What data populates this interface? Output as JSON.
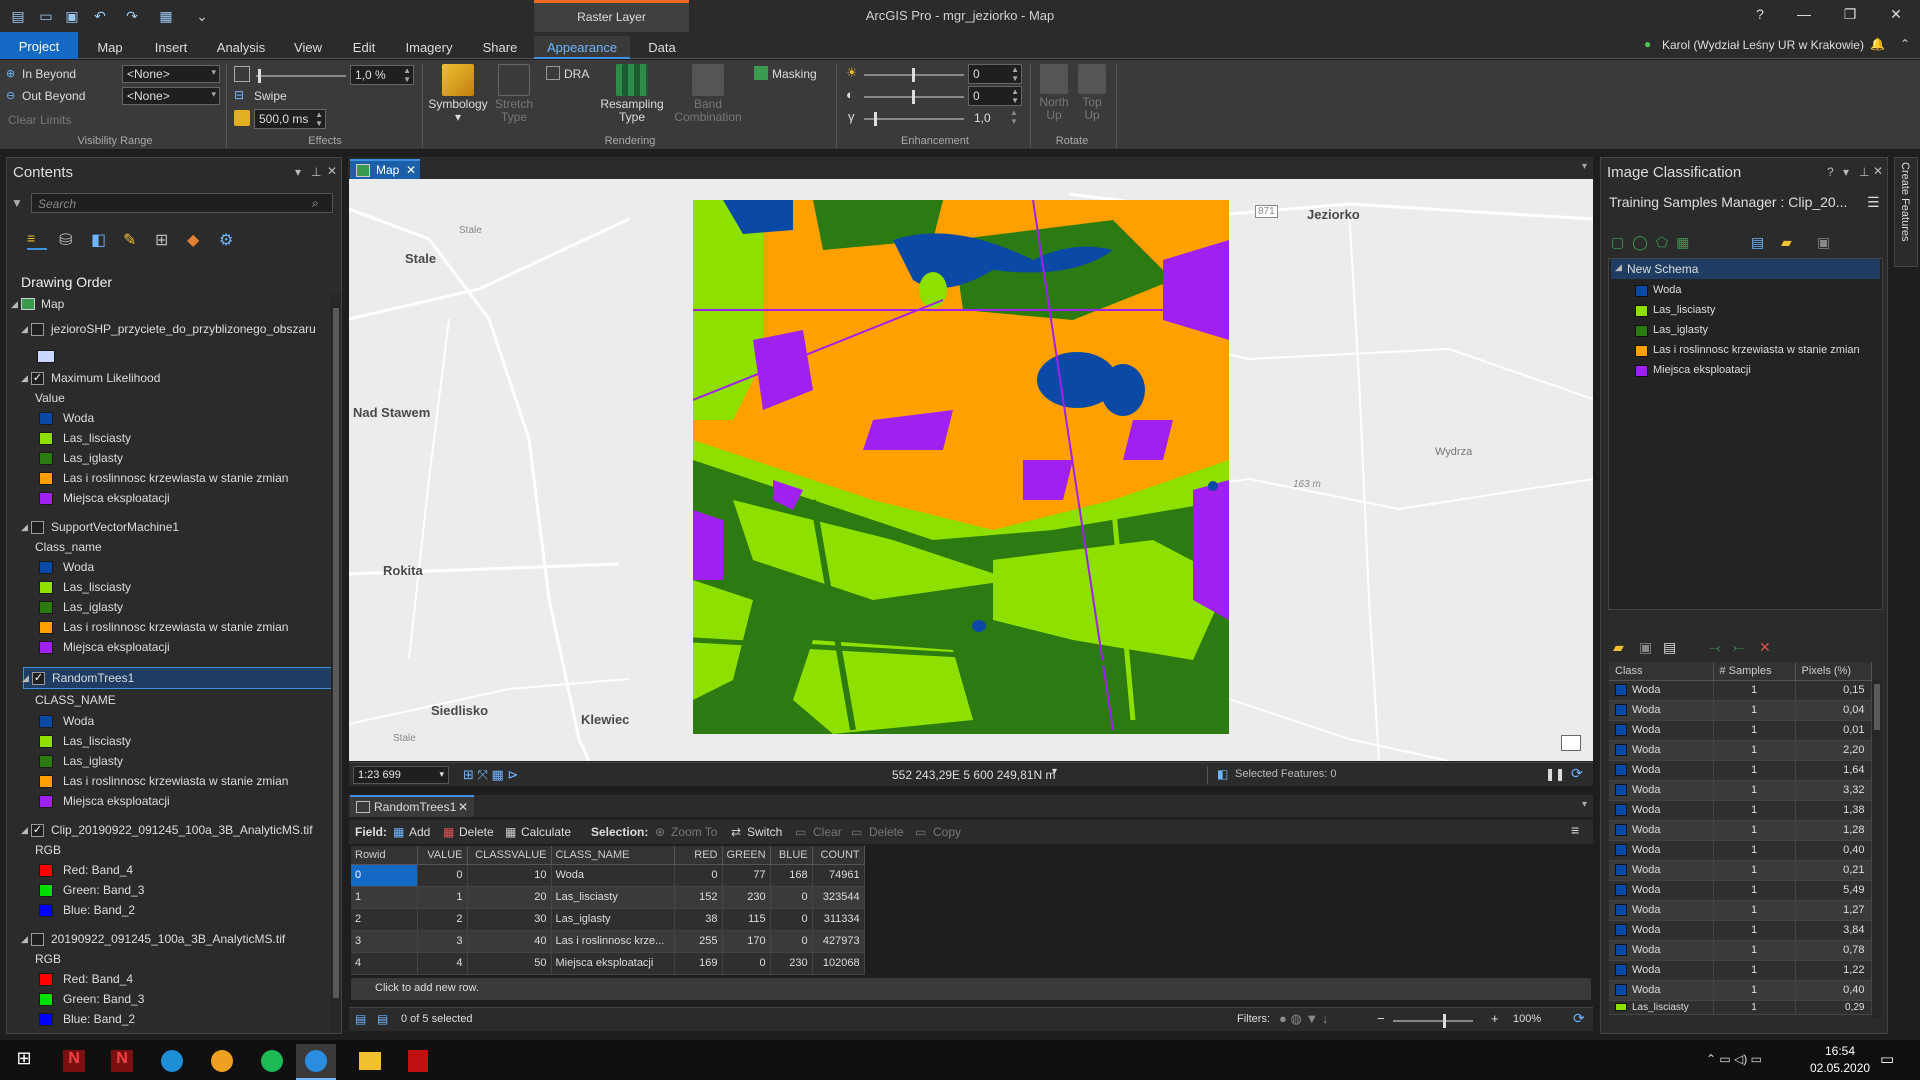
{
  "app": {
    "window_title": "ArcGIS Pro - mgr_jeziorko - Map",
    "contextual_tab_group": "Raster Layer",
    "help": "?"
  },
  "tabs": [
    "Project",
    "Map",
    "Insert",
    "Analysis",
    "View",
    "Edit",
    "Imagery",
    "Share",
    "Appearance",
    "Data"
  ],
  "user": "Karol (Wydział Leśny UR w Krakowie)",
  "ribbon": {
    "visibility_range": {
      "label": "Visibility Range",
      "in_beyond": "In Beyond",
      "out_beyond": "Out Beyond",
      "in_value": "<None>",
      "out_value": "<None>",
      "clear_limits": "Clear Limits"
    },
    "effects": {
      "label": "Effects",
      "transparency_value": "1,0  %",
      "swipe": "Swipe",
      "flicker_value": "500,0  ms"
    },
    "rendering": {
      "label": "Rendering",
      "symbology": "Symbology",
      "stretch_type": "Stretch Type",
      "dra": "DRA",
      "resampling_type": "Resampling Type",
      "band_combination": "Band Combination",
      "masking": "Masking"
    },
    "enhancement": {
      "label": "Enhancement",
      "brightness": "0",
      "contrast": "0",
      "gamma": "1,0"
    },
    "rotate": {
      "label": "Rotate",
      "north_up": "North Up",
      "top_up": "Top Up"
    }
  },
  "contents": {
    "title": "Contents",
    "search_placeholder": "Search",
    "drawing_order": "Drawing Order",
    "map_label": "Map",
    "layers": {
      "jezioro": "jezioroSHP_przyciete_do_przyblizonego_obszaru",
      "ml": "Maximum Likelihood",
      "ml_field": "Value",
      "svm": "SupportVectorMachine1",
      "svm_field": "Class_name",
      "rt": "RandomTrees1",
      "rt_field": "CLASS_NAME",
      "clip": "Clip_20190922_091245_100a_3B_AnalyticMS.tif",
      "orig": "20190922_091245_100a_3B_AnalyticMS.tif",
      "rgb": "RGB",
      "red": "Red:  Band_4",
      "green": "Green: Band_3",
      "blue": "Blue:  Band_2"
    },
    "classes": [
      "Woda",
      "Las_lisciasty",
      "Las_iglasty",
      "Las i roslinnosc krzewiasta w stanie zmian",
      "Miejsca eksploatacji"
    ]
  },
  "colors": {
    "woda": "#0a4aa6",
    "las_lisciasty": "#8ee000",
    "las_iglasty": "#2c7a12",
    "las_zmian": "#ffa000",
    "miejsca": "#a020f0",
    "accent": "#1469c4"
  },
  "map": {
    "tab": "Map",
    "scale": "1:23 699",
    "coords": "552 243,29E 5 600 249,81N m",
    "selected_features": "Selected Features: 0",
    "labels": {
      "jeziorko": "Jeziorko",
      "stale": "Stale",
      "nad_stawem": "Nad Stawem",
      "rokita": "Rokita",
      "siedlisko": "Siedlisko",
      "klewiec": "Klewiec",
      "wydrza": "Wydrza",
      "elev": "163 m",
      "road": "871"
    }
  },
  "attribute_table": {
    "tab": "RandomTrees1",
    "field_label": "Field:",
    "add": "Add",
    "delete": "Delete",
    "calculate": "Calculate",
    "selection_label": "Selection:",
    "zoom_to": "Zoom To",
    "switch": "Switch",
    "clear": "Clear",
    "delete_sel": "Delete",
    "copy": "Copy",
    "columns": [
      "Rowid",
      "VALUE",
      "CLASSVALUE",
      "CLASS_NAME",
      "RED",
      "GREEN",
      "BLUE",
      "COUNT"
    ],
    "rows": [
      [
        "0",
        "0",
        "10",
        "Woda",
        "0",
        "77",
        "168",
        "74961"
      ],
      [
        "1",
        "1",
        "20",
        "Las_lisciasty",
        "152",
        "230",
        "0",
        "323544"
      ],
      [
        "2",
        "2",
        "30",
        "Las_iglasty",
        "38",
        "115",
        "0",
        "311334"
      ],
      [
        "3",
        "3",
        "40",
        "Las i roslinnosc krze...",
        "255",
        "170",
        "0",
        "427973"
      ],
      [
        "4",
        "4",
        "50",
        "Miejsca eksploatacji",
        "169",
        "0",
        "230",
        "102068"
      ]
    ],
    "add_row": "Click to add new row.",
    "selected_count": "0 of 5 selected",
    "filters": "Filters:",
    "zoom": "100%"
  },
  "image_classification": {
    "title": "Image Classification",
    "subtitle": "Training Samples Manager : Clip_20...",
    "schema": "New Schema",
    "columns": [
      "Class",
      "# Samples",
      "Pixels (%)"
    ],
    "samples": [
      [
        "Woda",
        "1",
        "0,15"
      ],
      [
        "Woda",
        "1",
        "0,04"
      ],
      [
        "Woda",
        "1",
        "0,01"
      ],
      [
        "Woda",
        "1",
        "2,20"
      ],
      [
        "Woda",
        "1",
        "1,64"
      ],
      [
        "Woda",
        "1",
        "3,32"
      ],
      [
        "Woda",
        "1",
        "1,38"
      ],
      [
        "Woda",
        "1",
        "1,28"
      ],
      [
        "Woda",
        "1",
        "0,40"
      ],
      [
        "Woda",
        "1",
        "0,21"
      ],
      [
        "Woda",
        "1",
        "5,49"
      ],
      [
        "Woda",
        "1",
        "1,27"
      ],
      [
        "Woda",
        "1",
        "3,84"
      ],
      [
        "Woda",
        "1",
        "0,78"
      ],
      [
        "Woda",
        "1",
        "1,22"
      ],
      [
        "Woda",
        "1",
        "0,40"
      ],
      [
        "Las_lisciasty",
        "1",
        "0,29"
      ]
    ]
  },
  "side_tab": "Create Features",
  "taskbar": {
    "time": "16:54",
    "date": "02.05.2020"
  }
}
